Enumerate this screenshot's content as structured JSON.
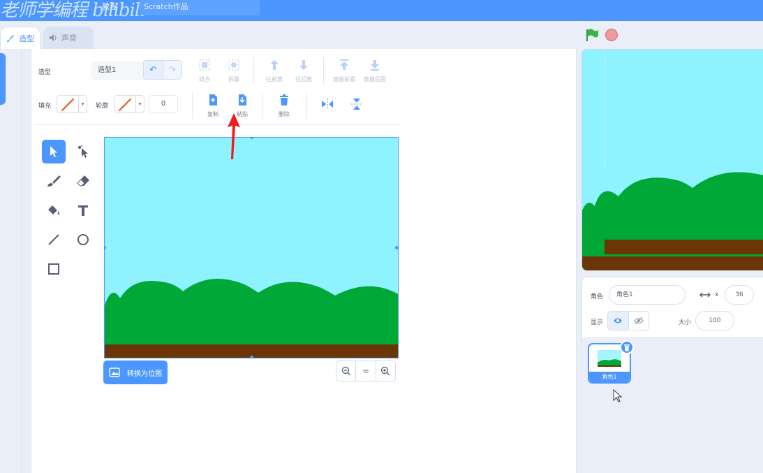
{
  "menubar": {
    "watermark": "老师学编程 bilibili",
    "tutorial_tab": "教程",
    "project_title": "Scratch作品"
  },
  "tabs": {
    "costume": "造型",
    "sound": "声音"
  },
  "paint": {
    "costume_label": "造型",
    "costume_name": "造型1",
    "fill_label": "填充",
    "outline_label": "轮廓",
    "outline_width": "0",
    "group": "组合",
    "ungroup": "拆散",
    "forward": "往前放",
    "backward": "往后放",
    "front": "放最前面",
    "back": "放最后面",
    "copy": "复制",
    "paste": "粘贴",
    "delete": "删除",
    "convert_bitmap": "转换为位图",
    "zoom_reset": "="
  },
  "sprite_info": {
    "sprite_label": "角色",
    "sprite_name": "角色1",
    "x_label": "x",
    "x_value": "36",
    "show_label": "显示",
    "size_label": "大小",
    "size_value": "100"
  },
  "sprite_list": {
    "items": [
      {
        "name": "角色1"
      }
    ]
  },
  "colors": {
    "accent": "#4c97ff",
    "sky": "#8ef2ff",
    "grass": "#00a838",
    "ground": "#6b3606",
    "annotation_arrow": "#ee1c1c"
  }
}
